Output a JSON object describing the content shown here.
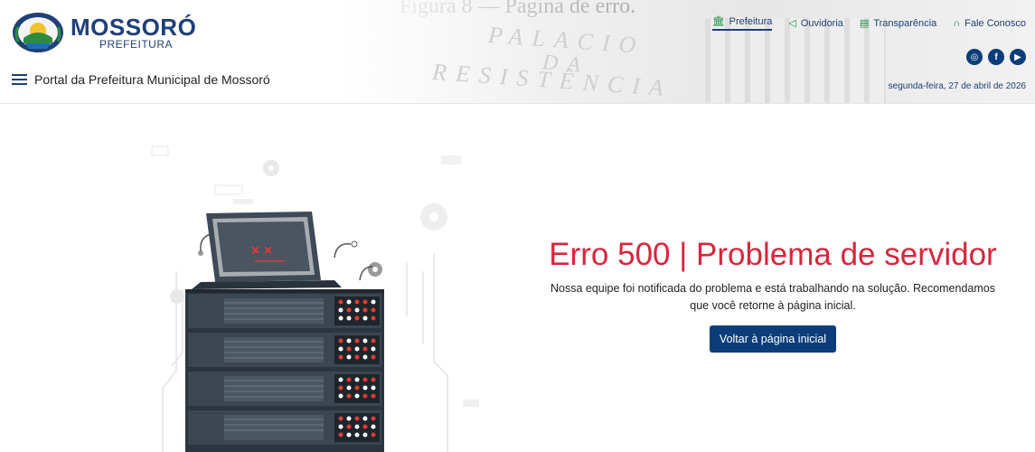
{
  "caption": "Figura 8 — Página de erro.",
  "header": {
    "logo_title": "MOSSORÓ",
    "logo_subtitle": "PREFEITURA",
    "portal_label": "Portal da Prefeitura Municipal de Mossoró",
    "date": "segunda-feira, 27 de abril de 2026",
    "background_engraving": [
      "PALACIO",
      "DA",
      "RESISTÊNCIA"
    ]
  },
  "topnav": [
    {
      "label": "Prefeitura",
      "icon": "building-icon",
      "active": true
    },
    {
      "label": "Ouvidoria",
      "icon": "megaphone-icon",
      "active": false
    },
    {
      "label": "Transparência",
      "icon": "document-icon",
      "active": false
    },
    {
      "label": "Fale Conosco",
      "icon": "headset-icon",
      "active": false
    }
  ],
  "social": [
    {
      "name": "instagram-icon",
      "glyph": "◎"
    },
    {
      "name": "facebook-icon",
      "glyph": "f"
    },
    {
      "name": "youtube-icon",
      "glyph": "▶"
    }
  ],
  "error": {
    "title": "Erro 500 | Problema de servidor",
    "message_line1": "Nossa equipe foi notificada do problema e está trabalhando na solução. Recomendamos",
    "message_line2": "que você retorne à página inicial.",
    "button_label": "Voltar à página inicial"
  },
  "colors": {
    "brand_blue": "#0a3d79",
    "error_red": "#d7263d",
    "nav_green": "#1c8b45"
  }
}
